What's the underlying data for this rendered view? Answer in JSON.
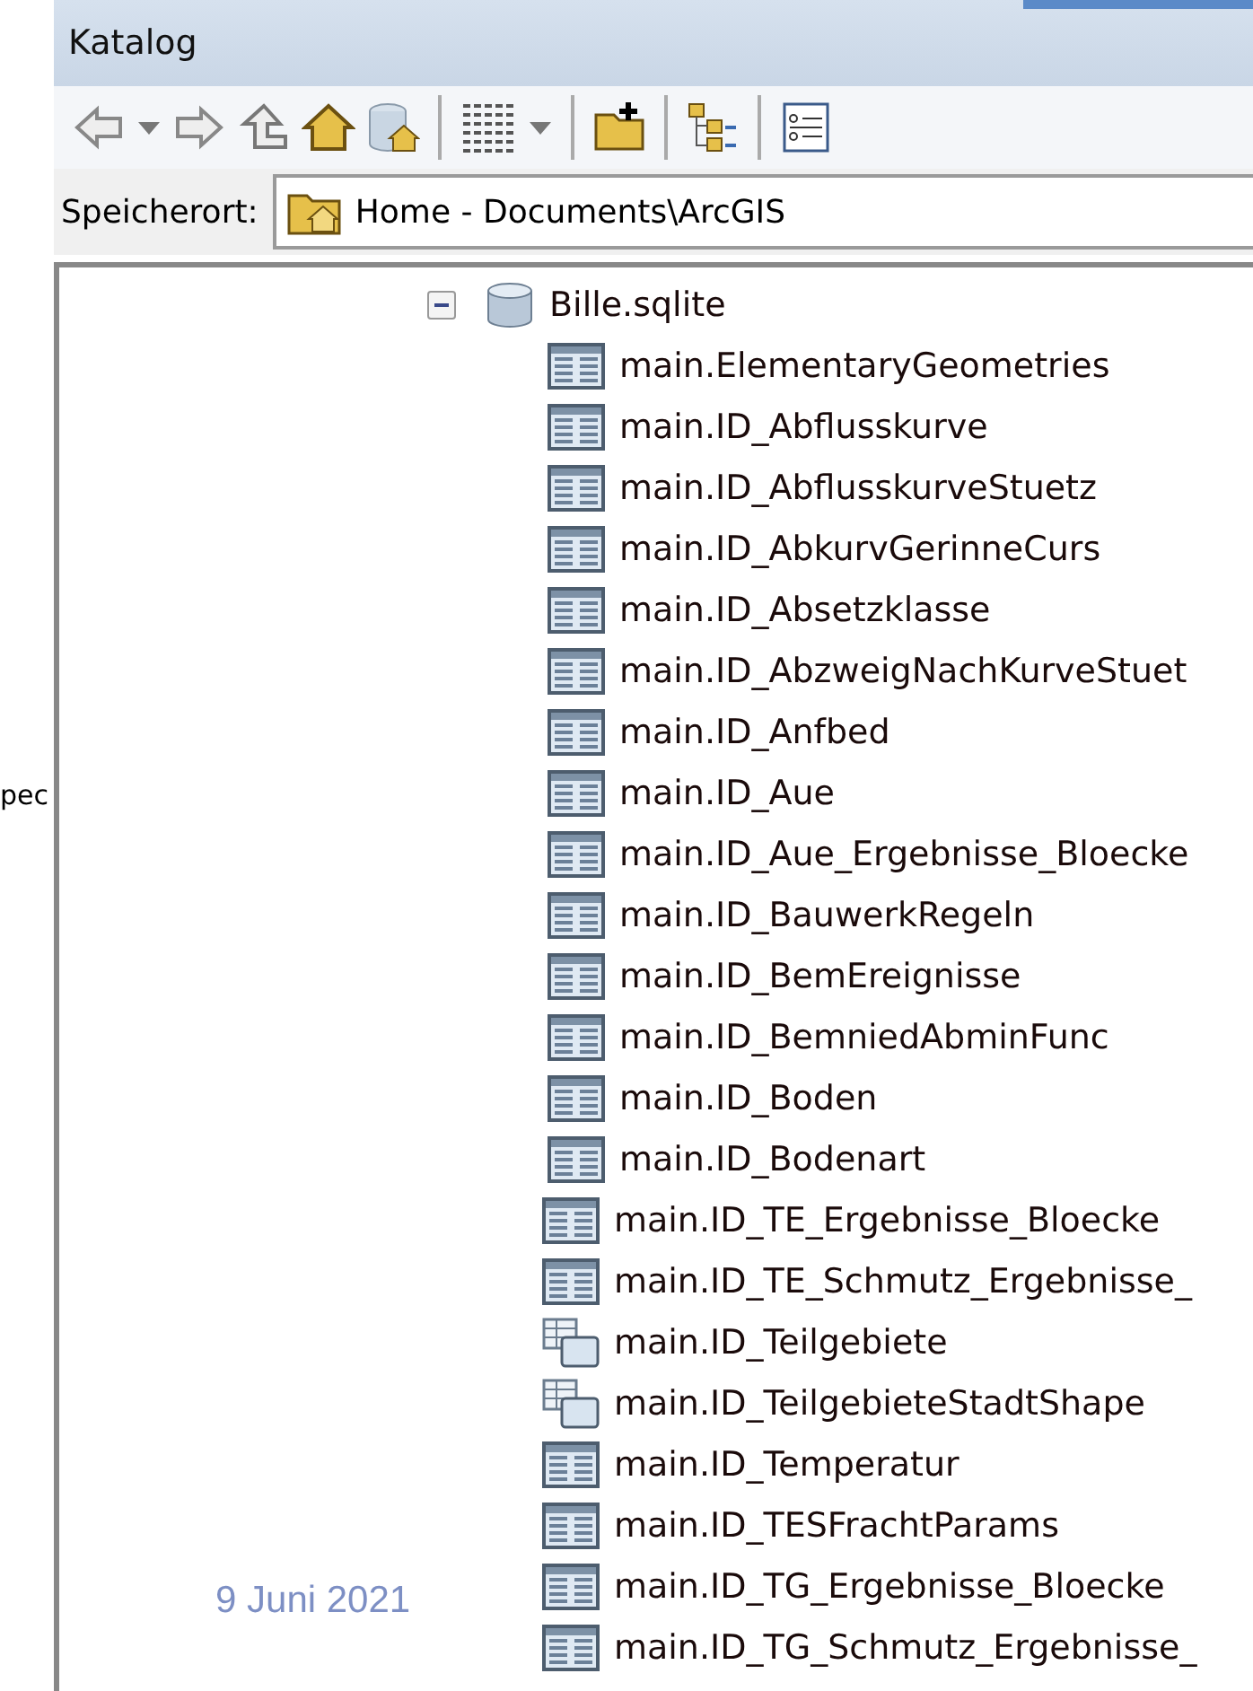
{
  "side_fragment": "pec",
  "panel": {
    "title": "Katalog"
  },
  "location": {
    "label": "Speicherort:",
    "value": "Home - Documents\\ArcGIS"
  },
  "tree": {
    "label": "Bille.sqlite",
    "expanded": true,
    "children": [
      {
        "kind": "table",
        "label": "main.ElementaryGeometries"
      },
      {
        "kind": "table",
        "label": "main.ID_Abflusskurve"
      },
      {
        "kind": "table",
        "label": "main.ID_AbflusskurveStuetz"
      },
      {
        "kind": "table",
        "label": "main.ID_AbkurvGerinneCurs"
      },
      {
        "kind": "table",
        "label": "main.ID_Absetzklasse"
      },
      {
        "kind": "table",
        "label": "main.ID_AbzweigNachKurveStuet"
      },
      {
        "kind": "table",
        "label": "main.ID_Anfbed"
      },
      {
        "kind": "table",
        "label": "main.ID_Aue"
      },
      {
        "kind": "table",
        "label": "main.ID_Aue_Ergebnisse_Bloecke"
      },
      {
        "kind": "table",
        "label": "main.ID_BauwerkRegeln"
      },
      {
        "kind": "table",
        "label": "main.ID_BemEreignisse"
      },
      {
        "kind": "table",
        "label": "main.ID_BemniedAbminFunc"
      },
      {
        "kind": "table",
        "label": "main.ID_Boden"
      },
      {
        "kind": "table",
        "label": "main.ID_Bodenart"
      },
      {
        "kind": "table",
        "label": "main.ID_TE_Ergebnisse_Bloecke"
      },
      {
        "kind": "table",
        "label": "main.ID_TE_Schmutz_Ergebnisse_"
      },
      {
        "kind": "feature",
        "label": "main.ID_Teilgebiete"
      },
      {
        "kind": "feature",
        "label": "main.ID_TeilgebieteStadtShape"
      },
      {
        "kind": "table",
        "label": "main.ID_Temperatur"
      },
      {
        "kind": "table",
        "label": "main.ID_TESFrachtParams"
      },
      {
        "kind": "table",
        "label": "main.ID_TG_Ergebnisse_Bloecke"
      },
      {
        "kind": "table",
        "label": "main.ID_TG_Schmutz_Ergebnisse_"
      }
    ]
  },
  "footer_date": "9 Juni 2021"
}
